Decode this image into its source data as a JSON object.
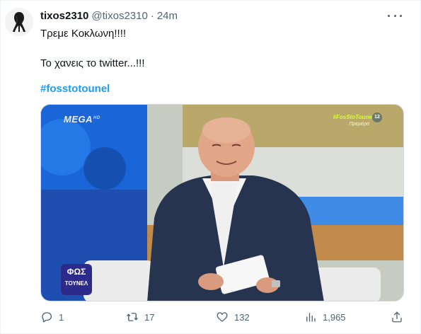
{
  "tweet": {
    "display_name": "tixos2310",
    "handle": "@tixos2310",
    "separator": "·",
    "time": "24m",
    "line1": "Τρεμε Κοκλωνη!!!!",
    "line2": "Το χανεις το twitter...!!!",
    "hashtag": "#fosstotounel",
    "more_icon": "more-horizontal-icon"
  },
  "media": {
    "channel_logo": "MEGA",
    "channel_suffix": "HD",
    "show_hashtag": "#FosStoTounel",
    "show_subtitle": "Πρεμιέρα",
    "rating": "12",
    "program_logo_top": "ΦΩΣ",
    "program_logo_bottom": "ΤΟΥΝΕΛ"
  },
  "actions": {
    "reply": {
      "icon": "reply-icon",
      "count": "1"
    },
    "retweet": {
      "icon": "retweet-icon",
      "count": "17"
    },
    "like": {
      "icon": "heart-icon",
      "count": "132"
    },
    "views": {
      "icon": "views-icon",
      "count": "1,965"
    },
    "share": {
      "icon": "share-icon"
    }
  },
  "colors": {
    "text": "#0f1419",
    "secondary": "#536471",
    "link": "#1d9bf0",
    "border": "#cfd9de"
  }
}
